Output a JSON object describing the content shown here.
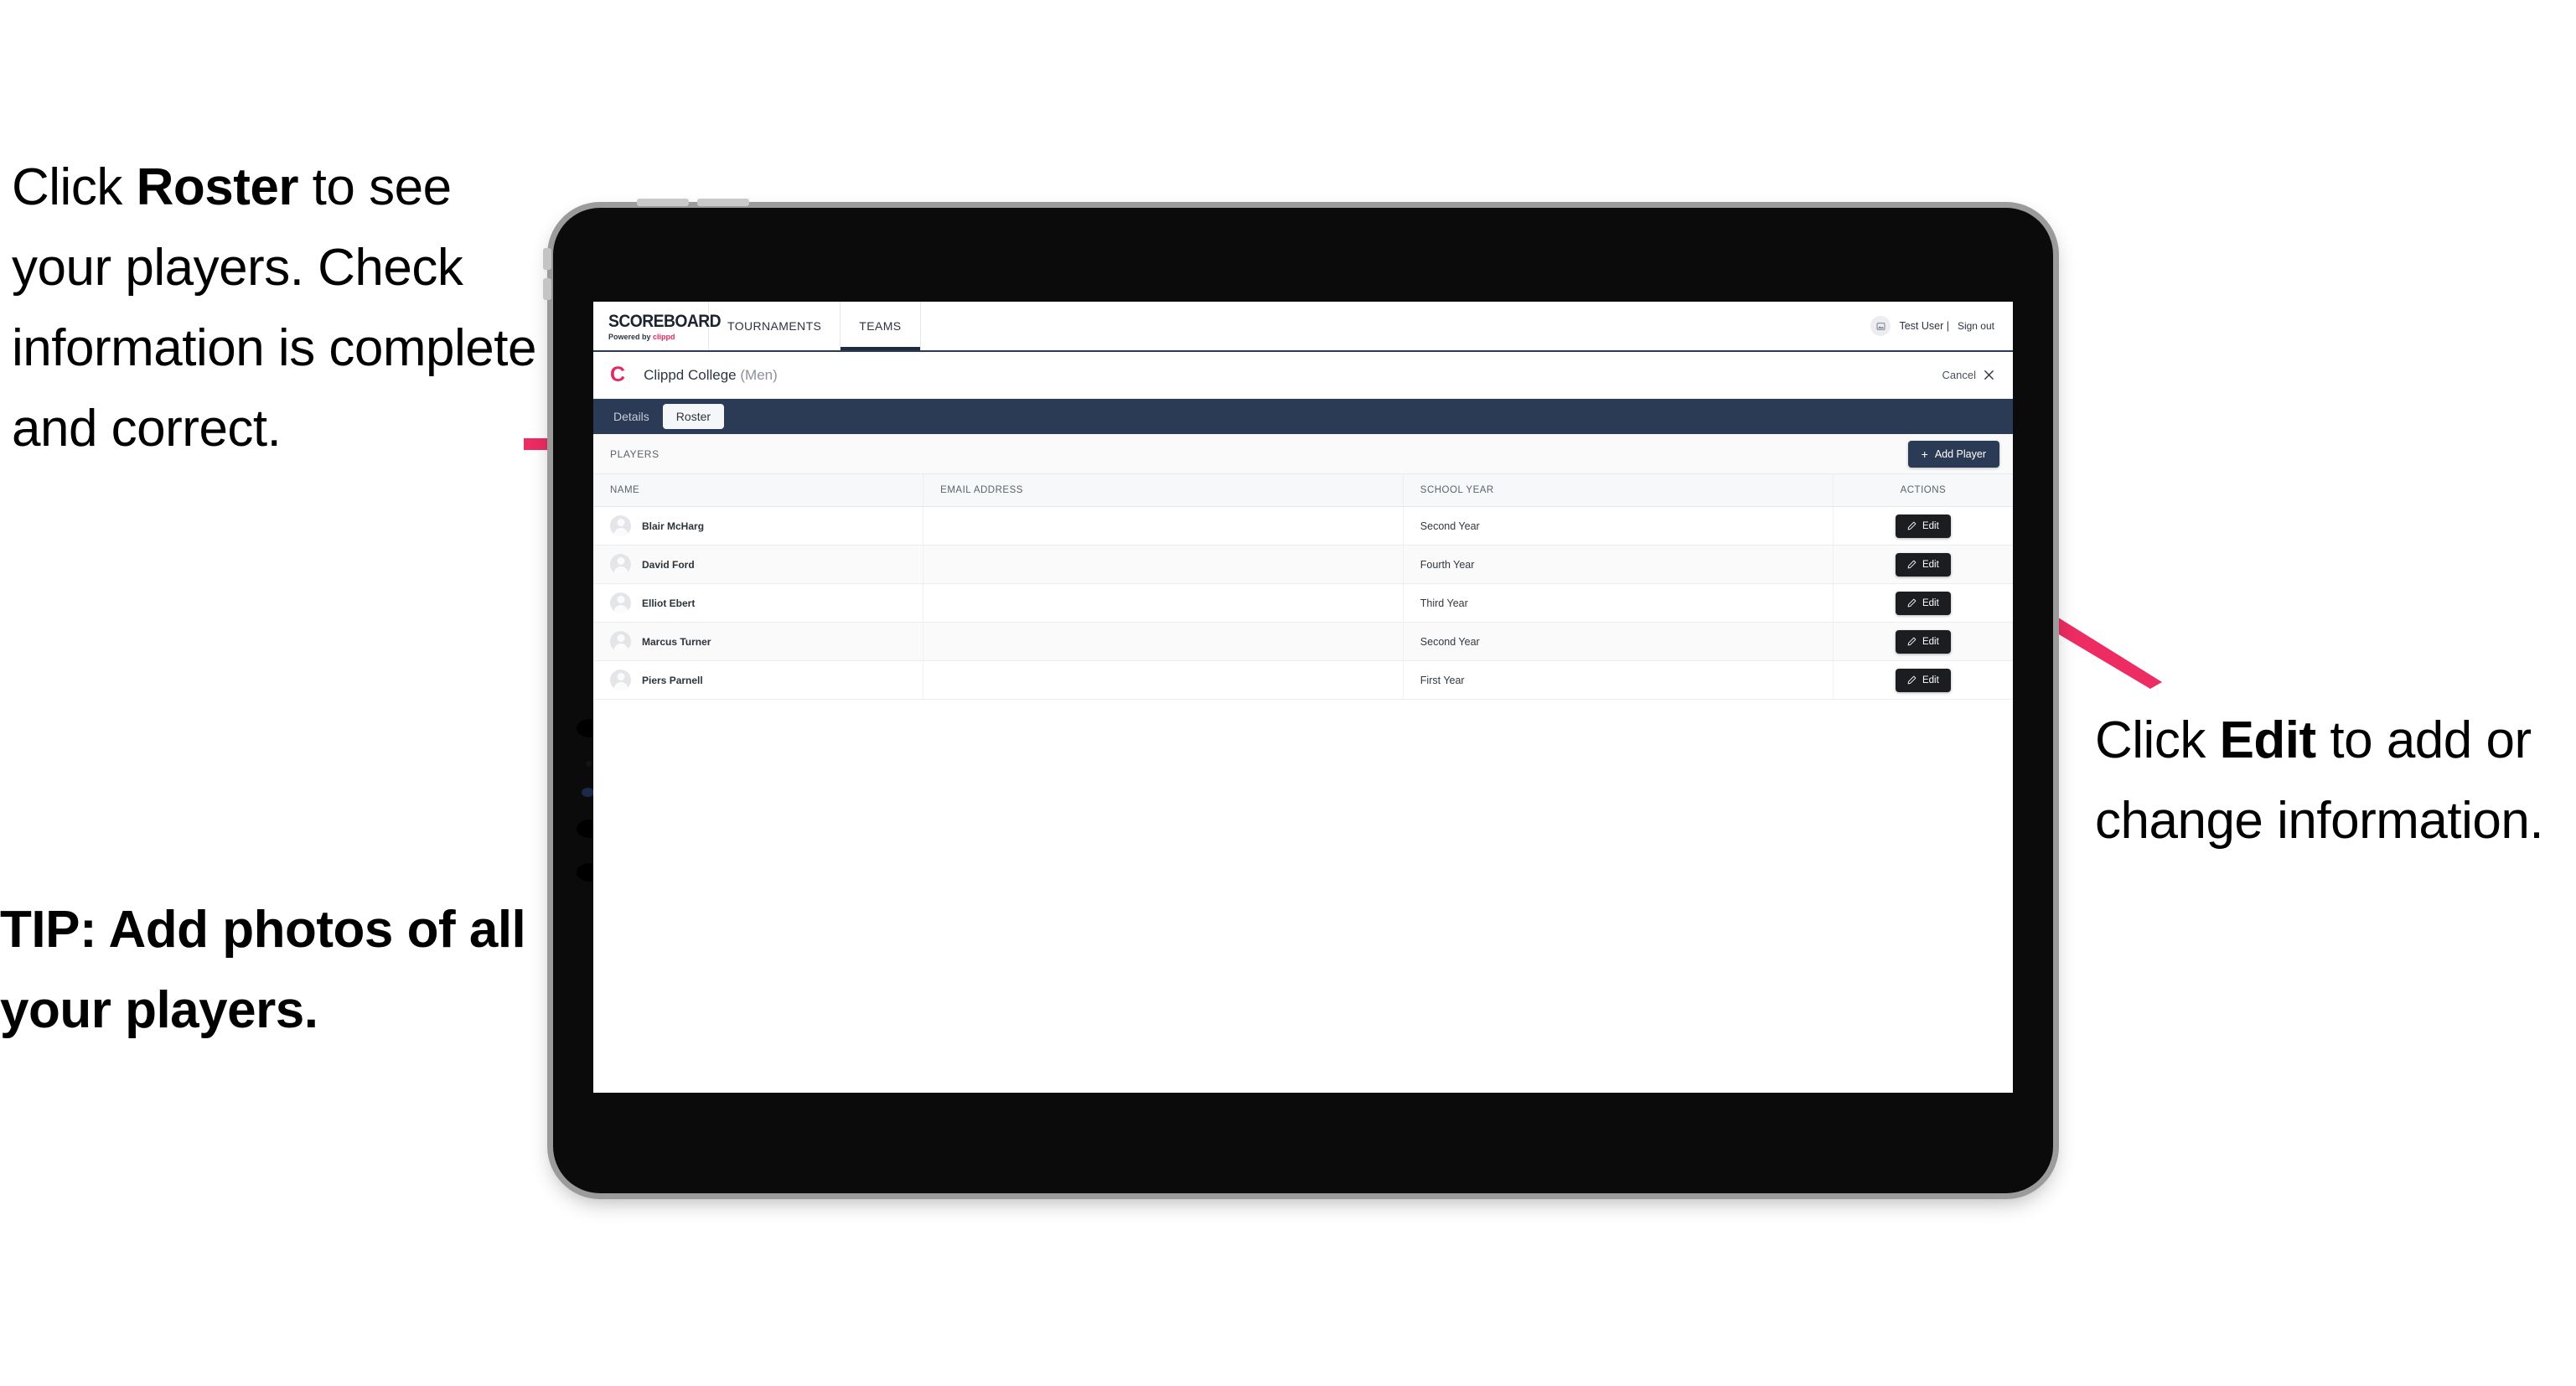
{
  "annotations": {
    "left": {
      "pre": "Click ",
      "bold": "Roster",
      "post": " to see your players. Check information is complete and correct."
    },
    "tip": "TIP: Add photos of all your players.",
    "right": {
      "pre": "Click ",
      "bold": "Edit",
      "post": " to add or change information."
    }
  },
  "colors": {
    "accent_pink": "#e8255f",
    "navy": "#2b3a55",
    "dark_button": "#1b1d20"
  },
  "app": {
    "brand": {
      "title": "SCOREBOARD",
      "powered_prefix": "Powered by ",
      "powered_name": "clippd"
    },
    "nav_tabs": [
      {
        "label": "TOURNAMENTS",
        "active": false
      },
      {
        "label": "TEAMS",
        "active": true
      }
    ],
    "user": {
      "avatar_icon": "image-icon",
      "name": "Test User |",
      "sign_out": "Sign out"
    },
    "team_header": {
      "logo_letter": "C",
      "name": "Clippd College",
      "qualifier": "(Men)",
      "cancel_label": "Cancel",
      "cancel_icon": "close-icon"
    },
    "sub_tabs": [
      {
        "label": "Details",
        "active": false
      },
      {
        "label": "Roster",
        "active": true
      }
    ],
    "players_section": {
      "label": "PLAYERS",
      "add_player_label": "Add Player",
      "add_player_icon": "plus-icon"
    },
    "table": {
      "columns": [
        "NAME",
        "EMAIL ADDRESS",
        "SCHOOL YEAR",
        "ACTIONS"
      ],
      "action_label": "Edit",
      "action_icon": "pencil-icon",
      "rows": [
        {
          "name": "Blair McHarg",
          "email": "",
          "school_year": "Second Year"
        },
        {
          "name": "David Ford",
          "email": "",
          "school_year": "Fourth Year"
        },
        {
          "name": "Elliot Ebert",
          "email": "",
          "school_year": "Third Year"
        },
        {
          "name": "Marcus Turner",
          "email": "",
          "school_year": "Second Year"
        },
        {
          "name": "Piers Parnell",
          "email": "",
          "school_year": "First Year"
        }
      ]
    }
  }
}
